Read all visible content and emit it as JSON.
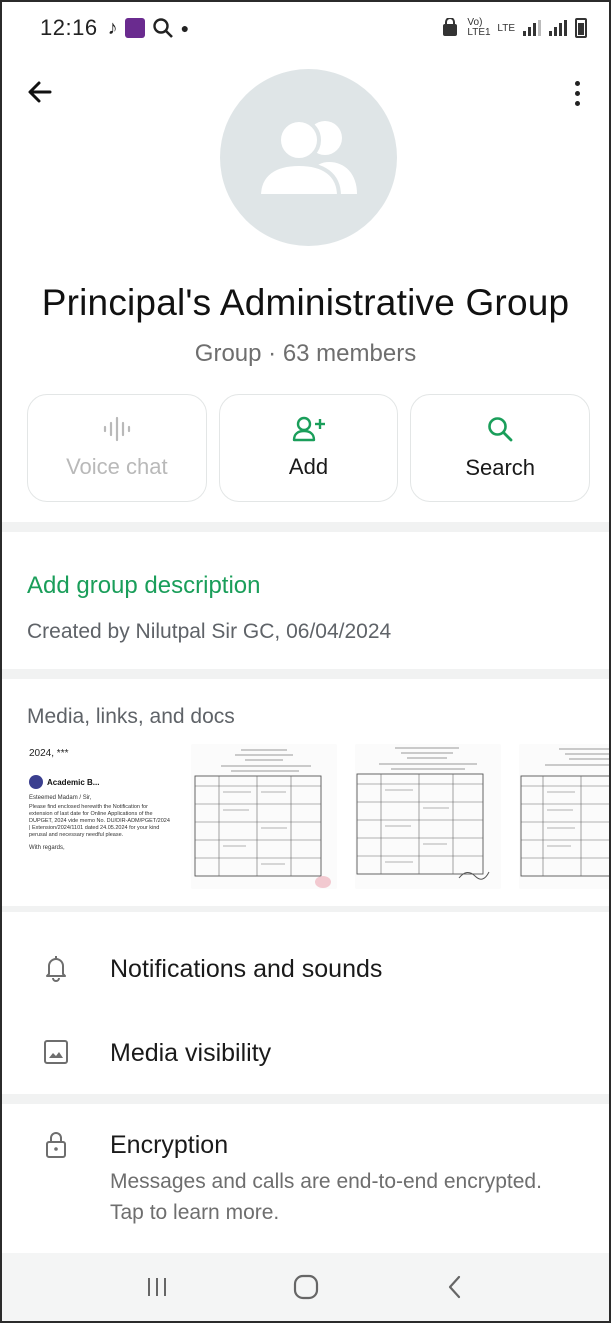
{
  "status_bar": {
    "time": "12:16",
    "network_label": "LTE",
    "carrier_label": "Vo) LTE1"
  },
  "header": {
    "back_icon": "arrow-left-icon",
    "more_icon": "more-vertical-icon"
  },
  "group": {
    "avatar_icon": "group-icon",
    "name": "Principal's Administrative Group",
    "subtitle": "Group · 63 members"
  },
  "actions": [
    {
      "label": "Voice chat",
      "icon": "audio-wave-icon",
      "enabled": false
    },
    {
      "label": "Add",
      "icon": "add-person-icon",
      "enabled": true
    },
    {
      "label": "Search",
      "icon": "search-icon",
      "enabled": true
    }
  ],
  "description": {
    "add_label": "Add group description",
    "created_by": "Created by Nilutpal Sir GC, 06/04/2024"
  },
  "media": {
    "title": "Media, links, and docs",
    "email_preview": {
      "date_line": "2024, ***",
      "sender": "Academic B...",
      "salutation": "Esteemed Madam / Sir,",
      "body": "Please find enclosed herewith the Notification for extension of last date for Online Applications of the DUPGET, 2024 vide memo No. DU/DIR-ADM/PGET/2024 | Extension/2024/1101 dated 24.05.2024 for your kind perusal and necessary needful please.",
      "sign_off": "With regards,"
    }
  },
  "settings": {
    "notifications_label": "Notifications and sounds",
    "media_visibility_label": "Media visibility",
    "encryption_label": "Encryption",
    "encryption_sub": "Messages and calls are end-to-end encrypted. Tap to learn more."
  },
  "colors": {
    "accent": "#1a9e5a",
    "avatar_bg": "#dfe5e7",
    "divider": "#f1f2f2"
  }
}
